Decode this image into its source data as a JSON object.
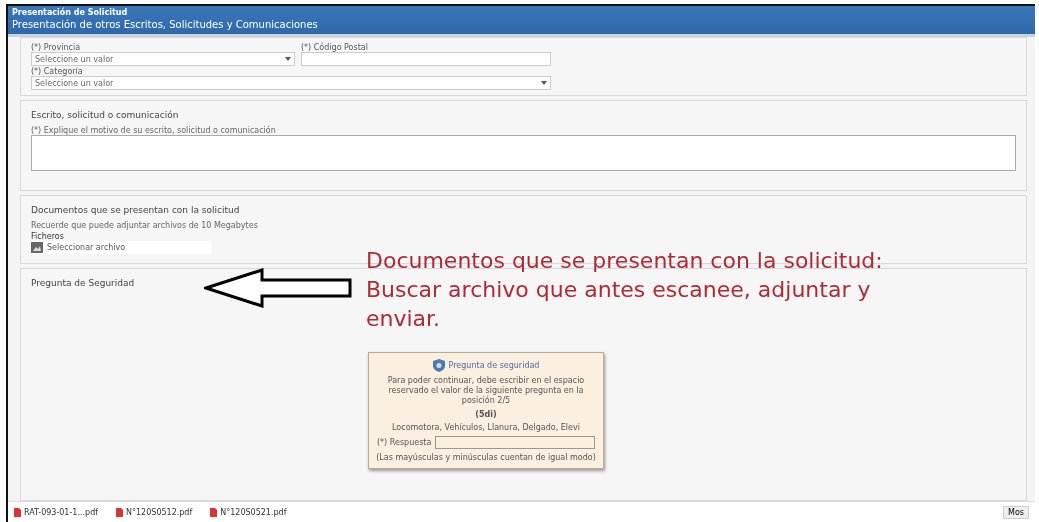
{
  "header": {
    "title": "Presentación de Solicitud",
    "subtitle": "Presentación de otros Escritos, Solicitudes y Comunicaciones"
  },
  "location": {
    "fields": [
      {
        "label": "(*) Provincia",
        "kind": "select",
        "value": "Seleccione un valor"
      },
      {
        "label": "(*) Código Postal",
        "kind": "input"
      },
      {
        "label": "(*) Categoría",
        "kind": "select",
        "value": "Seleccione un valor"
      }
    ]
  },
  "writing": {
    "title": "Escrito, solicitud o comunicación",
    "label": "(*) Explique el motivo de su escrito, solicitud o comunicación"
  },
  "documents": {
    "title": "Documentos que se presentan con la solicitud",
    "hint": "Recuerde que puede adjuntar archivos de 10 Megabytes",
    "files_label": "Ficheros",
    "file_button": "Seleccionar archivo"
  },
  "security": {
    "title": "Pregunta de Seguridad"
  },
  "annotation": {
    "lines": [
      "Documentos que se presentan con la solicitud:",
      "Buscar archivo que antes escanee, adjuntar y",
      "enviar."
    ]
  },
  "popup": {
    "title": "Pregunta de seguridad",
    "text": "Para poder continuar, debe escribir en el espacio reservado el valor de la siguiente pregunta en la posición 2/5",
    "code": "(5di)",
    "options": "Locomotora, Vehículos, Llanura, Delgado, Elevi",
    "answer_label": "(*) Respuesta",
    "note": "(Las mayúsculas y minúsculas cuentan de igual modo)"
  },
  "downloads": {
    "items": [
      {
        "name": "RAT-093-01-1...pdf"
      },
      {
        "name": "N°120S0512.pdf"
      },
      {
        "name": "N°120S0521.pdf"
      }
    ],
    "button": "Mos"
  }
}
